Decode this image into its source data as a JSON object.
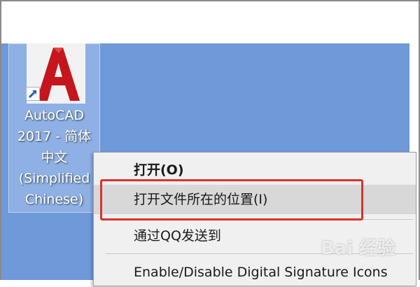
{
  "colors": {
    "desktop": "#6f99d9",
    "menu_background": "#f0f0f0",
    "hover": "#d8d8d8",
    "highlight_border": "#d9342b",
    "autocad_red": "#c4161c"
  },
  "desktop_icon": {
    "icon": "autocad-app-icon",
    "label_lines": [
      "AutoCAD",
      "2017 - 简体",
      "中文",
      "(Simplified",
      "Chinese)"
    ]
  },
  "context_menu": {
    "items": [
      {
        "label": "打开(O)"
      },
      {
        "label": "打开文件所在的位置(I)"
      },
      {
        "label": "通过QQ发送到"
      },
      {
        "label": "Enable/Disable Digital Signature Icons"
      }
    ]
  },
  "watermark": {
    "text": "Bai 经验",
    "icon": "baidu-paw-icon"
  }
}
